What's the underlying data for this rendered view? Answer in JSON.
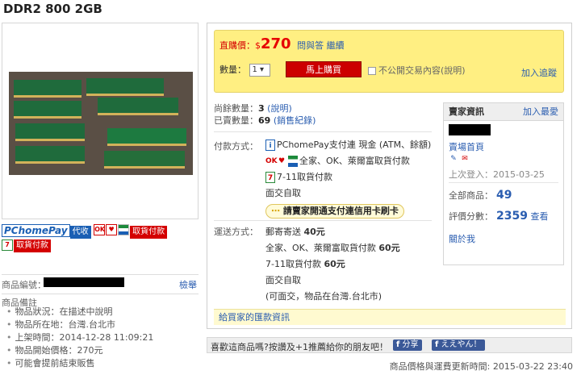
{
  "product": {
    "title": "DDR2 800 2GB"
  },
  "left_badges": {
    "pchome_pay": "PChomePay",
    "proxy_collect": "代收",
    "store_tag": "取貨付款",
    "seven_tag": "取貨付款",
    "ok_icon": "OK"
  },
  "left_info": {
    "code_label": "商品編號：",
    "report_label": "檢舉",
    "remarks_label": "商品備註",
    "remarks": [
      "物品狀況：在描述中說明",
      "物品所在地：台灣.台北市",
      "上架時間：2014-12-28  11:09:21",
      "物品開始價格：270元",
      "可能會提前結束販售"
    ]
  },
  "buy": {
    "price_label": "直購價：",
    "currency": "$",
    "price": "270",
    "qa_link": "問與答",
    "continue_link": "繼續",
    "qty_label": "數量：",
    "qty_value": "1 ▾",
    "buy_button": "馬上購買",
    "private_label": "不公開交易內容(說明)",
    "track_link": "加入追蹤"
  },
  "stock": {
    "remaining_label": "尚餘數量：",
    "remaining": "3",
    "remaining_link": "(說明)",
    "sold_label": "已賣數量：",
    "sold": "69",
    "sold_link": "(銷售紀錄)"
  },
  "payment": {
    "label": "付款方式：",
    "methods": [
      "PChomePay支付連 現金 (ATM、餘額)",
      "全家、OK、萊爾富取貨付款",
      "7-11取貨付款",
      "面交自取"
    ],
    "credit_note": "請賣家開通支付連信用卡刷卡"
  },
  "shipping": {
    "label": "運送方式：",
    "methods": [
      {
        "name": "郵寄寄送",
        "fee": "40元"
      },
      {
        "name": "全家、OK、萊爾富取貨付款",
        "fee": "60元"
      },
      {
        "name": "7-11取貨付款",
        "fee": "60元"
      },
      {
        "name": "面交自取",
        "fee": ""
      }
    ],
    "note": "(可面交，物品在台灣.台北市)"
  },
  "remit_bar": "給買家的匯款資訊",
  "seller": {
    "header": "賣家資訊",
    "fav_link": "加入最愛",
    "shop_link": "賣場首頁",
    "last_login": "上次登入：2015-03-25",
    "all_items_label": "全部商品：",
    "all_items": "49",
    "score_label": "評價分數：",
    "score": "2359",
    "score_link": "查看",
    "about_link": "關於我"
  },
  "share": {
    "text": "喜歡這商品嗎?按讚及+1推薦給你的朋友吧！",
    "fb_share": "分享",
    "fb_like": "ええやん！"
  },
  "footer": {
    "update_time": "商品價格與運費更新時間: 2015-03-22  23:40"
  },
  "colors": {
    "accent_red": "#e60000",
    "link_blue": "#2a5db0",
    "buy_panel_yellow": "#ffef82"
  }
}
